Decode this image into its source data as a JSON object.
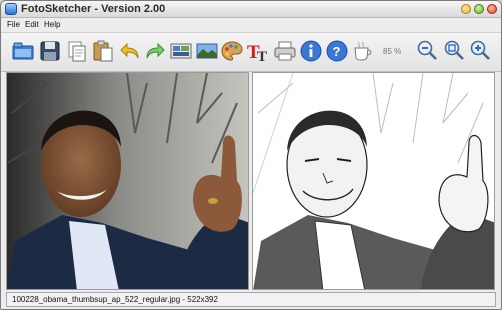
{
  "window": {
    "title": "FotoSketcher - Version 2.00"
  },
  "menu": {
    "items": [
      "File",
      "Edit",
      "Help"
    ]
  },
  "toolbar": {
    "buttons": [
      "open-icon",
      "save-icon",
      "copy-icon",
      "paste-icon",
      "undo-icon",
      "redo-icon",
      "original-image-icon",
      "sketch-image-icon",
      "palette-icon",
      "text-icon",
      "print-icon",
      "info-icon",
      "help-icon",
      "coffee-icon"
    ],
    "zoom_label": "85 %",
    "zoom_buttons": [
      "zoom-out-icon",
      "zoom-fit-icon",
      "zoom-in-icon"
    ]
  },
  "status": {
    "text": "100228_obama_thumbsup_ap_522_regular.jpg - 522x392"
  },
  "colors": {
    "accent": "#2a6fd6",
    "close": "#d94a2a",
    "minimize": "#e8b23a",
    "maximize": "#6fb43a"
  }
}
